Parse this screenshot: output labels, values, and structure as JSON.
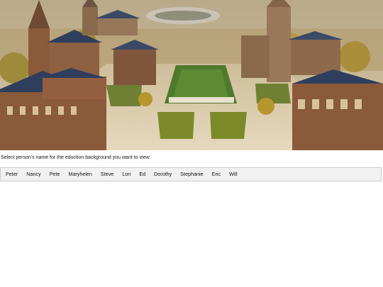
{
  "prompt": {
    "text": "Select person's name for the eduction background you want to view:"
  },
  "tabs": [
    {
      "label": "Peter"
    },
    {
      "label": "Nancy"
    },
    {
      "label": "Pete"
    },
    {
      "label": "Maryhelen"
    },
    {
      "label": "Steve"
    },
    {
      "label": "Lori"
    },
    {
      "label": "Ed"
    },
    {
      "label": "Dorothy"
    },
    {
      "label": "Stephanie"
    },
    {
      "label": "Eric"
    },
    {
      "label": "Will"
    }
  ],
  "hero": {
    "colors": {
      "sky": "#c9b896",
      "brick": "#8a5a3a",
      "roof": "#2f3e5c",
      "lawn": "#4f7a2c",
      "plaza": "#d8c9a8",
      "trees": "#a5892f"
    }
  }
}
